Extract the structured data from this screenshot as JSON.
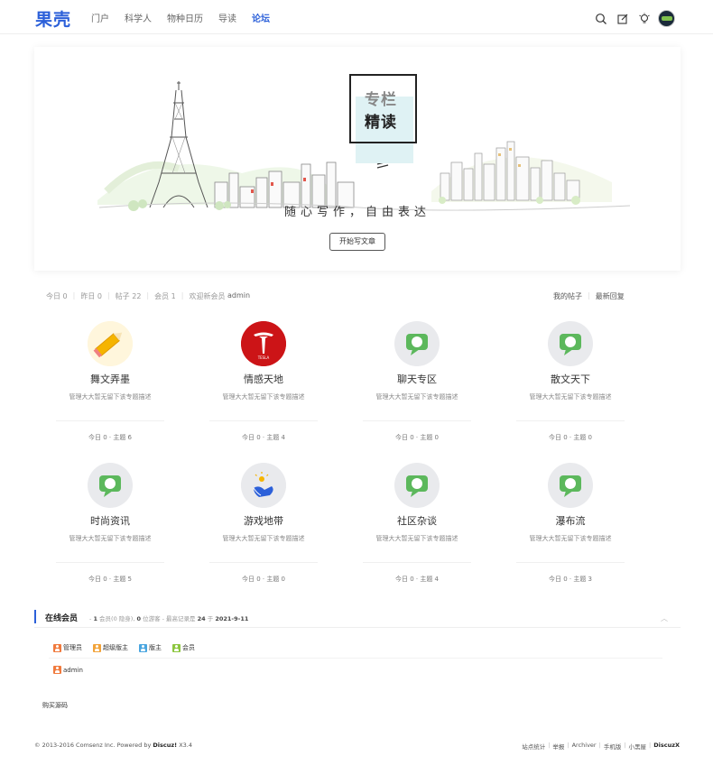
{
  "header": {
    "logo": "果壳",
    "nav": [
      "门户",
      "科学人",
      "物种日历",
      "导读",
      "论坛"
    ],
    "active_nav": "论坛",
    "icons": [
      "search-icon",
      "edit-icon",
      "bulb-icon",
      "user-avatar"
    ]
  },
  "banner": {
    "column_line1": "专栏",
    "column_line2": "精读",
    "slogan": "随心写作，自由表达",
    "write_button": "开始写文章"
  },
  "stats": {
    "today": "今日 0",
    "yesterday": "昨日 0",
    "posts": "帖子 22",
    "members": "会员 1",
    "newest_label": "欢迎新会员",
    "newest": "admin",
    "my_posts": "我的帖子",
    "latest_replies": "最新回复"
  },
  "forums": [
    {
      "name": "舞文弄墨",
      "desc": "管理大大暂无留下该专题描述",
      "meta": "今日 0 · 主题 6",
      "icon": "pencil-icon"
    },
    {
      "name": "情感天地",
      "desc": "管理大大暂无留下该专题描述",
      "meta": "今日 0 · 主题 4",
      "icon": "tesla-logo-icon"
    },
    {
      "name": "聊天专区",
      "desc": "管理大大暂无留下该专题描述",
      "meta": "今日 0 · 主题 0",
      "icon": "chat-bubble-icon"
    },
    {
      "name": "散文天下",
      "desc": "管理大大暂无留下该专题描述",
      "meta": "今日 0 · 主题 0",
      "icon": "chat-bubble-icon"
    },
    {
      "name": "时尚资讯",
      "desc": "管理大大暂无留下该专题描述",
      "meta": "今日 0 · 主题 5",
      "icon": "chat-bubble-icon"
    },
    {
      "name": "游戏地带",
      "desc": "管理大大暂无留下该专题描述",
      "meta": "今日 0 · 主题 0",
      "icon": "idea-hand-icon"
    },
    {
      "name": "社区杂谈",
      "desc": "管理大大暂无留下该专题描述",
      "meta": "今日 0 · 主题 4",
      "icon": "chat-bubble-icon"
    },
    {
      "name": "瀑布流",
      "desc": "管理大大暂无留下该专题描述",
      "meta": "今日 0 · 主题 3",
      "icon": "chat-bubble-icon"
    }
  ],
  "online": {
    "title": "在线会员",
    "dash": "-",
    "count": "1",
    "members_text": "会员(0 隐身),",
    "guests": "0",
    "guests_text": "位游客 - 最高记录是",
    "record": "24",
    "on": "于",
    "date": "2021-9-11",
    "legend": [
      {
        "label": "管理员",
        "color": "#f07a3d"
      },
      {
        "label": "超级版主",
        "color": "#f2a33a"
      },
      {
        "label": "版主",
        "color": "#4aa6e0"
      },
      {
        "label": "会员",
        "color": "#8cc63f"
      }
    ],
    "member": "admin"
  },
  "buy_link": "购买源码",
  "footer": {
    "copyright": "© 2013-2016 Comsenz Inc.  Powered by",
    "brand": "Discuz!",
    "version": "X3.4",
    "links": [
      "站点统计",
      "举报",
      "Archiver",
      "手机版",
      "小黑屋"
    ],
    "brand_right": "DiscuzX"
  }
}
